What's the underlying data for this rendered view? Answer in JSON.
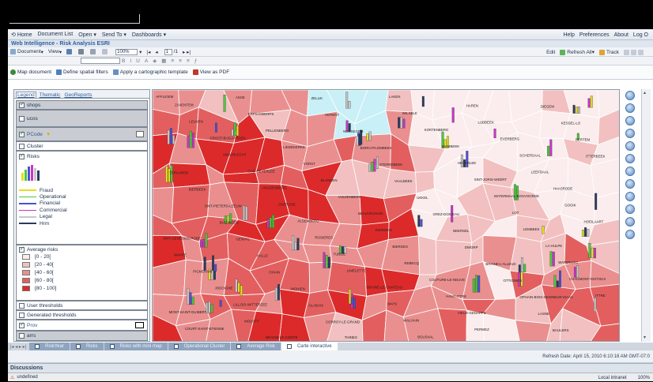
{
  "menubar": {
    "home": "Home",
    "document_list": "Document List",
    "open": "Open",
    "send_to": "Send To",
    "dashboards": "Dashboards",
    "help": "Help",
    "preferences": "Preferences",
    "about": "About",
    "logout": "Log O"
  },
  "app_title": "Web Intelligence - Risk Analysis ESRI",
  "toolbar": {
    "document": "Document",
    "view": "View",
    "zoom": "100%",
    "page": "1",
    "page_total": "/1",
    "edit": "Edit",
    "refresh_all": "Refresh All",
    "track": "Track"
  },
  "map_toolbar": {
    "map_document": "Map document",
    "define_filters": "Define spatial filters",
    "apply_template": "Apply a cartographic template",
    "view_pdf": "View as PDF"
  },
  "left_panel": {
    "tabs": [
      "Legend",
      "Thematic",
      "GeoReports"
    ],
    "layers": {
      "shops": "shops",
      "ucos": "ucos",
      "pcode": "PCode",
      "cluster": "Cluster",
      "risks": "Risks",
      "user_thresholds": "User thresholds",
      "generated_thresholds": "Generated thresholds",
      "prov": "Prov",
      "arrs": "arrs"
    },
    "risk_lines": [
      {
        "label": "Fraud",
        "color": "#e6df1f"
      },
      {
        "label": "Operational",
        "color": "#49c83b"
      },
      {
        "label": "Financial",
        "color": "#4e4fd4"
      },
      {
        "label": "Commercial",
        "color": "#c935c9"
      },
      {
        "label": "Legal",
        "color": "#c7c7c7"
      },
      {
        "label": "Hrm",
        "color": "#2b3a5e"
      }
    ],
    "average_risks": {
      "title": "Average risks",
      "classes": [
        {
          "label": "[0 - 20[",
          "color": "#fbeded"
        },
        {
          "label": "[20 - 40[",
          "color": "#f2c0c0"
        },
        {
          "label": "[40 - 60[",
          "color": "#ea8f8f"
        },
        {
          "label": "[60 - 80[",
          "color": "#e35f5f"
        },
        {
          "label": "[80 - 100]",
          "color": "#dc2a2a"
        }
      ]
    }
  },
  "map_labels": [
    "AFFLIGEM",
    "ASSE",
    "ZELLIK",
    "LAKEN",
    "HAREN",
    "DIEGEM",
    "ZAVENTEM",
    "ERPS-KWERPS",
    "HERENT",
    "WILSELE",
    "LUBBEEK",
    "KESSEL-LO",
    "LEUVEN",
    "PELLENBERG",
    "NOSSEGEM",
    "KORTENBERG",
    "EVERBERG",
    "BERTEM",
    "GROOT-BIJGAARDEN",
    "LIEDEKERKE",
    "BORCHTLOMBEEK",
    "WAMBEEK",
    "SCHEPDAAL",
    "ITTERBEEK",
    "ANDERLECHT",
    "VORST",
    "STERREBEEK",
    "HEVERLEE",
    "LEEFDAAL",
    "TERVUREN",
    "OUD-HEVERLEE",
    "BLANDEN",
    "VAALBEEK",
    "SINT-JORIS-WEERT",
    "HAASRODE",
    "BIERBEEK",
    "HULDENBERG",
    "VLEZENBEEK",
    "UKKEL",
    "WATERMAAL-BOSVOORDE",
    "GOOIK",
    "SINT-PIETERS-LEEUW",
    "OVERIJSE",
    "BEAUVECHAIN",
    "GREZ-DOICEAU",
    "LOT",
    "HOEILAART",
    "BUIZINGEN",
    "ALSEMBERG",
    "EIZINGEN",
    "BEERSEL",
    "LEMBEEK",
    "SINT-GENESIUS-RODE",
    "GENVAL",
    "ROSIERES",
    "BIERGES",
    "DWORP",
    "LA HULPE",
    "WAVRE",
    "HALLE",
    "TUBIZE",
    "REBECQ",
    "BRAINE-L'ALLEUD",
    "WATERLOO",
    "PIGNEHAIN",
    "OHAIN",
    "LIMELETTE",
    "COUTURE-LE-NEUVE",
    "OTTIGNIES",
    "CHAUMONT-GISTOUX",
    "JODOIGNE",
    "INGHIEN",
    "BRAINE-LE-CHATEAU",
    "HAUT-ITTRE",
    "OPHAIN-BOIS-SEIGNEUR-ISAAC",
    "ITTRE",
    "LILLOIS-WITTERZEE",
    "GLABAIS",
    "WAYS",
    "VIEUX-GENAPPE",
    "LASNE",
    "MONT-SAINT-GUIBERT",
    "MOUSTY",
    "CORROY-LE-GRAND",
    "WALHAIN",
    "PERWEZ",
    "BAULERS",
    "COURT-SAINT-ETIENNE",
    "BRAINE-LE-COMTE",
    "THINES",
    "BOUSVAL"
  ],
  "report_tabs": [
    "RiskYear",
    "Risks",
    "Risks with mini map",
    "Operational Cluster",
    "Average Risk",
    "Carte interactive"
  ],
  "refresh_date": "Refresh Date: April 15, 2010 6:10:18 AM GMT-07:0",
  "discussions": "Discussions",
  "status": {
    "left": "undefined",
    "zone": "Local intranet",
    "zoom": "100%"
  }
}
